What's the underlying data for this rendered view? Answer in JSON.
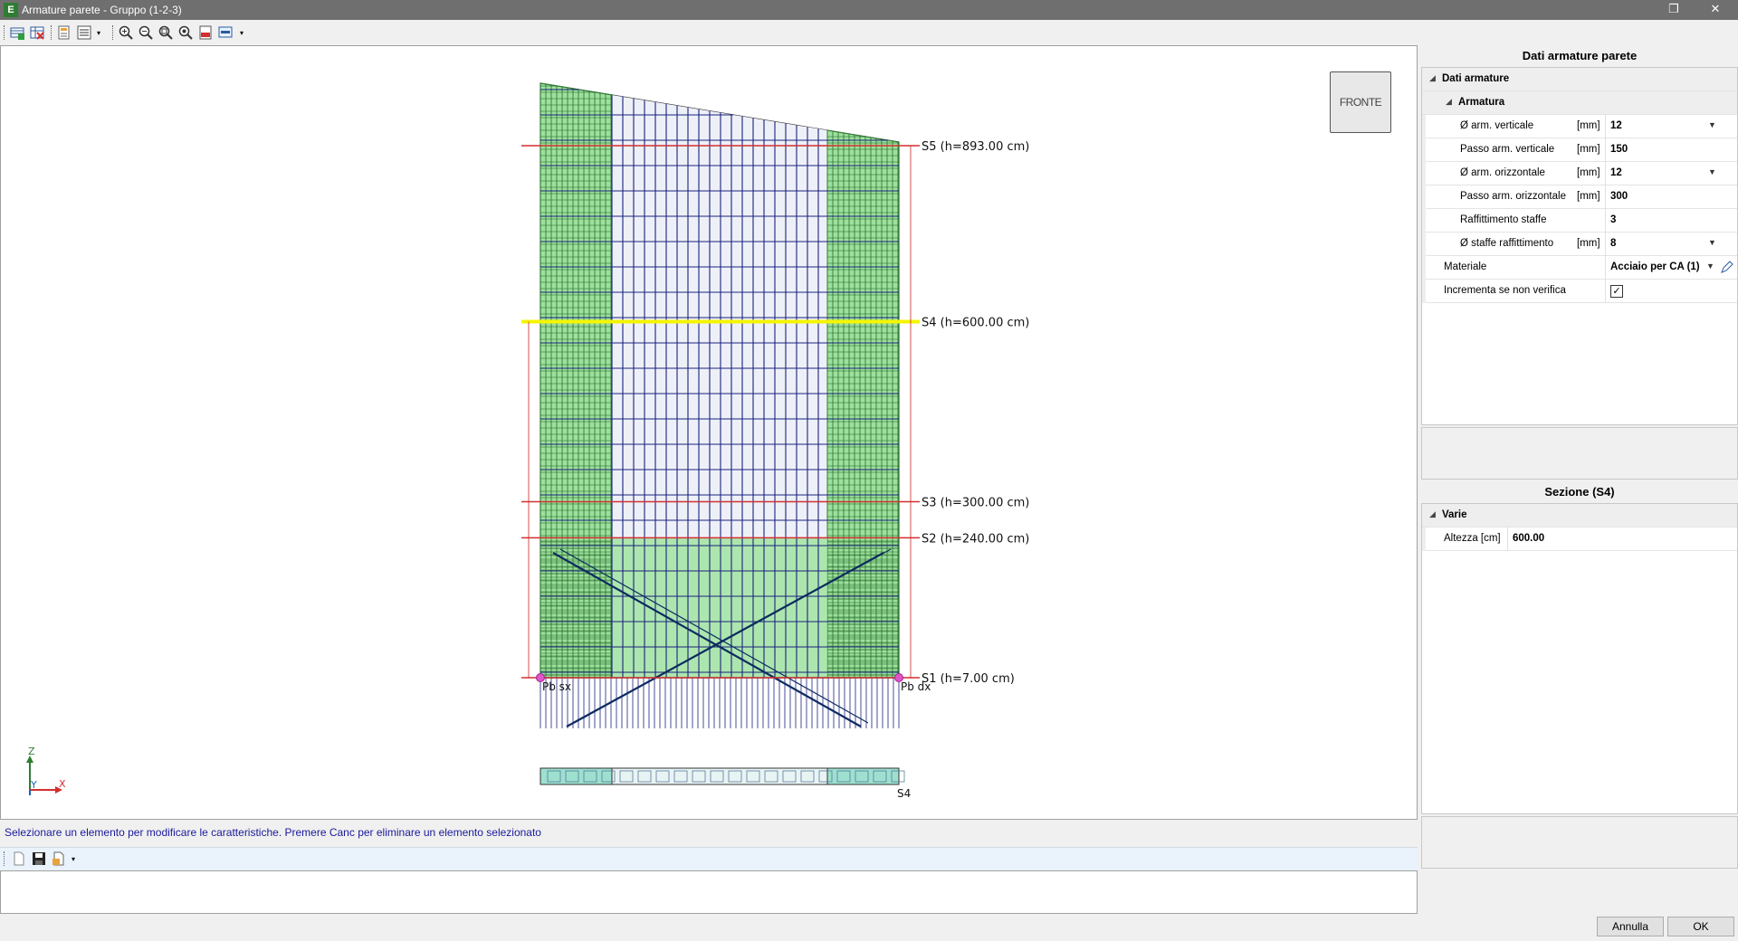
{
  "window": {
    "title": "Armature parete - Gruppo (1-2-3)",
    "app_icon_letter": "E",
    "restore_glyph": "❐",
    "close_glyph": "✕"
  },
  "toolbar": {
    "icons": [
      "add-row-icon",
      "delete-grid-icon",
      "properties-icon",
      "list-icon",
      "zoom-in-icon",
      "zoom-out-icon",
      "zoom-window-icon",
      "zoom-extents-icon",
      "export-pdf-icon",
      "display-icon"
    ]
  },
  "canvas": {
    "nav_cube_label": "FRONTE",
    "sections": [
      {
        "label": "S5 (h=893.00 cm)",
        "h": 893,
        "highlight": false
      },
      {
        "label": "S4 (h=600.00 cm)",
        "h": 600,
        "highlight": true
      },
      {
        "label": "S3 (h=300.00 cm)",
        "h": 300,
        "highlight": false
      },
      {
        "label": "S2 (h=240.00 cm)",
        "h": 240,
        "highlight": false
      },
      {
        "label": "S1 (h=7.00 cm)",
        "h": 7,
        "highlight": false
      }
    ],
    "base_left_label": "Pb sx",
    "base_right_label": "Pb dx",
    "section_strip_label": "S4",
    "axis": {
      "z": "Z",
      "y": "Y",
      "x": "X"
    },
    "colors": {
      "section_line": "#d32f2f",
      "selected_section": "#f5f500",
      "band_fill": "#7cd67c",
      "rebar": "#1a237e"
    }
  },
  "status_message": "Selezionare un elemento per modificare le caratteristiche. Premere Canc per eliminare un elemento selezionato",
  "panel_armature": {
    "title": "Dati armature parete",
    "category": "Dati armature",
    "subcategory": "Armatura",
    "rows": [
      {
        "label": "Ø arm. verticale",
        "unit": "[mm]",
        "value": "12",
        "dropdown": true
      },
      {
        "label": "Passo arm. verticale",
        "unit": "[mm]",
        "value": "150",
        "dropdown": false
      },
      {
        "label": "Ø arm. orizzontale",
        "unit": "[mm]",
        "value": "12",
        "dropdown": true
      },
      {
        "label": "Passo arm. orizzontale",
        "unit": "[mm]",
        "value": "300",
        "dropdown": false
      },
      {
        "label": "Raffittimento staffe",
        "unit": "",
        "value": "3",
        "dropdown": false
      },
      {
        "label": "Ø staffe raffittimento",
        "unit": "[mm]",
        "value": "8",
        "dropdown": true
      }
    ],
    "material_label": "Materiale",
    "material_value": "Acciaio per CA (1)",
    "increment_label": "Incrementa se non verifica",
    "increment_checked": true
  },
  "panel_section": {
    "title": "Sezione (S4)",
    "category": "Varie",
    "height_label": "Altezza [cm]",
    "height_value": "600.00"
  },
  "buttons": {
    "cancel": "Annulla",
    "ok": "OK"
  }
}
